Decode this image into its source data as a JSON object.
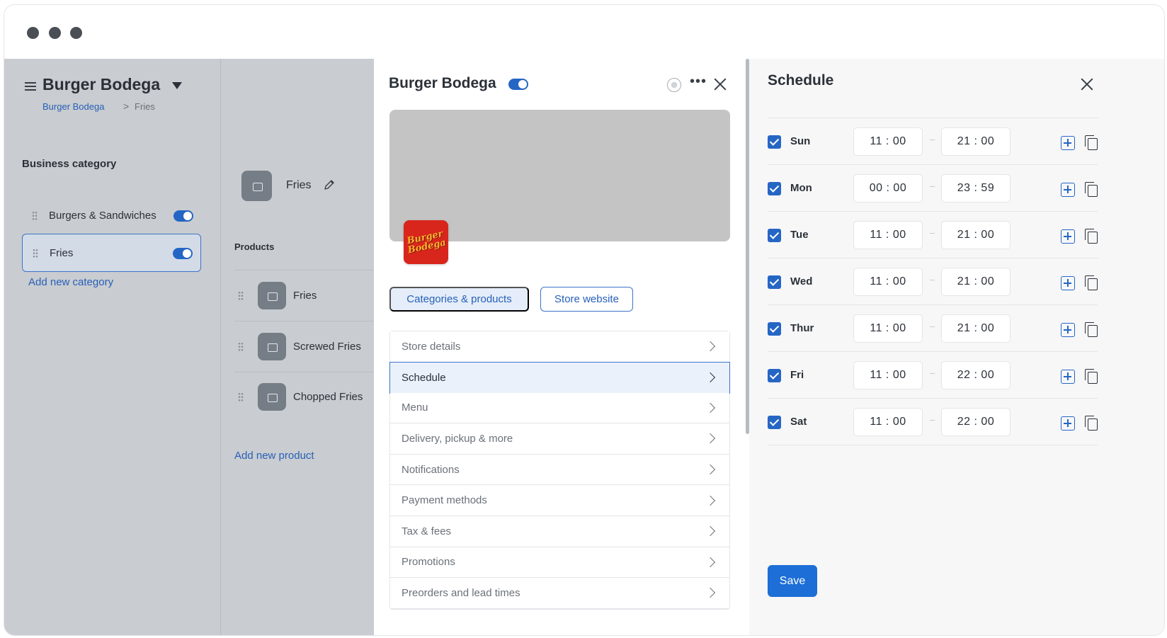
{
  "background_app": {
    "store_title": "Burger Bodega",
    "breadcrumb": {
      "link": "Burger Bodega",
      "separator": ">",
      "current": "Fries"
    },
    "section_heading": "Business category",
    "categories": [
      {
        "label": "Burgers & Sandwiches",
        "enabled": true,
        "active": false
      },
      {
        "label": "Fries",
        "enabled": true,
        "active": true
      }
    ],
    "add_category_label": "Add new category",
    "selected_category_title": "Fries",
    "products_heading": "Products",
    "products": [
      {
        "name": "Fries"
      },
      {
        "name": "Screwed Fries"
      },
      {
        "name": "Chopped Fries"
      }
    ],
    "add_product_label": "Add new product"
  },
  "store_panel": {
    "title": "Burger Bodega",
    "enabled": true,
    "more_label": "•••",
    "logo_text": "Burger Bodega",
    "tabs": {
      "primary": "Categories & products",
      "secondary": "Store website"
    },
    "menu_items": [
      {
        "label": "Store details",
        "active": false
      },
      {
        "label": "Schedule",
        "active": true
      },
      {
        "label": "Menu",
        "active": false
      },
      {
        "label": "Delivery, pickup & more",
        "active": false
      },
      {
        "label": "Notifications",
        "active": false
      },
      {
        "label": "Payment methods",
        "active": false
      },
      {
        "label": "Tax & fees",
        "active": false
      },
      {
        "label": "Promotions",
        "active": false
      },
      {
        "label": "Preorders and lead times",
        "active": false
      }
    ]
  },
  "schedule": {
    "title": "Schedule",
    "days": [
      {
        "day": "Sun",
        "checked": true,
        "open": "11 : 00",
        "close": "21 : 00",
        "dash": "–"
      },
      {
        "day": "Mon",
        "checked": true,
        "open": "00 : 00",
        "close": "23 : 59",
        "dash": "–"
      },
      {
        "day": "Tue",
        "checked": true,
        "open": "11 : 00",
        "close": "21 : 00",
        "dash": "–"
      },
      {
        "day": "Wed",
        "checked": true,
        "open": "11 : 00",
        "close": "21 : 00",
        "dash": "–"
      },
      {
        "day": "Thur",
        "checked": true,
        "open": "11 : 00",
        "close": "21 : 00",
        "dash": "–"
      },
      {
        "day": "Fri",
        "checked": true,
        "open": "11 : 00",
        "close": "22 : 00",
        "dash": "–"
      },
      {
        "day": "Sat",
        "checked": true,
        "open": "11 : 00",
        "close": "22 : 00",
        "dash": "–"
      }
    ],
    "save_label": "Save"
  },
  "colors": {
    "accent": "#2566c4",
    "overlay": "#c9ccd0",
    "schedule_bg": "#f7f7f8"
  }
}
